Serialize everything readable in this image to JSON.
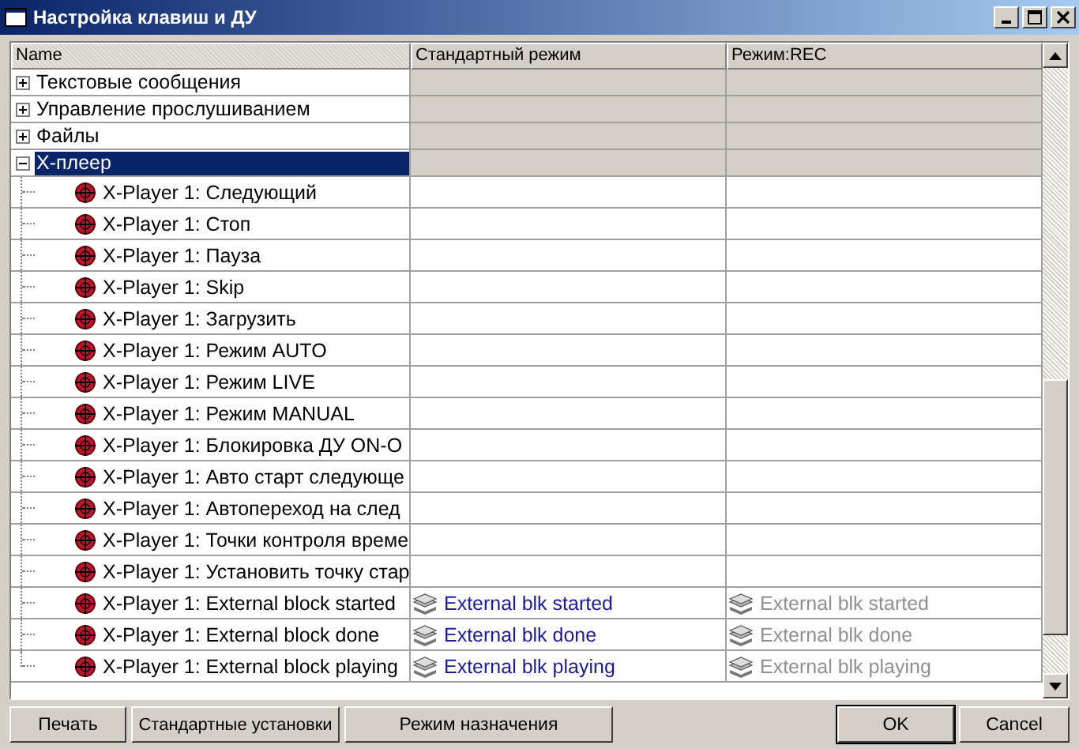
{
  "window": {
    "title": "Настройка клавиш и ДУ"
  },
  "table": {
    "columns": [
      "Name",
      "Стандартный режим",
      "Режим:REC"
    ],
    "rows": [
      {
        "label": "Текстовые сообщения",
        "expanded": false,
        "selected": false
      },
      {
        "label": "Управление прослушиванием",
        "expanded": false,
        "selected": false
      },
      {
        "label": "Файлы",
        "expanded": false,
        "selected": false
      },
      {
        "label": "X-плеер",
        "expanded": true,
        "selected": true,
        "children": [
          {
            "label": "X-Player 1: Следующий"
          },
          {
            "label": "X-Player 1: Стоп"
          },
          {
            "label": "X-Player 1: Пауза"
          },
          {
            "label": "X-Player 1: Skip"
          },
          {
            "label": "X-Player 1: Загрузить"
          },
          {
            "label": "X-Player 1: Режим AUTO"
          },
          {
            "label": "X-Player 1: Режим LIVE"
          },
          {
            "label": "X-Player 1: Режим MANUAL"
          },
          {
            "label": "X-Player 1: Блокировка ДУ ON-O"
          },
          {
            "label": "X-Player 1: Авто старт следующе"
          },
          {
            "label": "X-Player 1: Автопереход на след"
          },
          {
            "label": "X-Player 1: Точки контроля време"
          },
          {
            "label": "X-Player 1: Установить точку стар"
          },
          {
            "label": "X-Player 1: External block started",
            "cells": [
              {
                "text": "External blk started",
                "disabled": false
              },
              {
                "text": "External blk started",
                "disabled": true
              }
            ]
          },
          {
            "label": "X-Player 1: External block done",
            "cells": [
              {
                "text": "External blk done",
                "disabled": false
              },
              {
                "text": "External blk done",
                "disabled": true
              }
            ]
          },
          {
            "label": "X-Player 1: External block playing",
            "cells": [
              {
                "text": "External blk playing",
                "disabled": false
              },
              {
                "text": "External blk playing",
                "disabled": true
              }
            ]
          }
        ]
      }
    ]
  },
  "buttons": [
    {
      "label": "Печать",
      "default": false
    },
    {
      "label": "Стандартные установки",
      "default": false
    },
    {
      "label": "Режим назначения",
      "default": false
    },
    {
      "label": "OK",
      "default": true
    },
    {
      "label": "Cancel",
      "default": false
    }
  ]
}
